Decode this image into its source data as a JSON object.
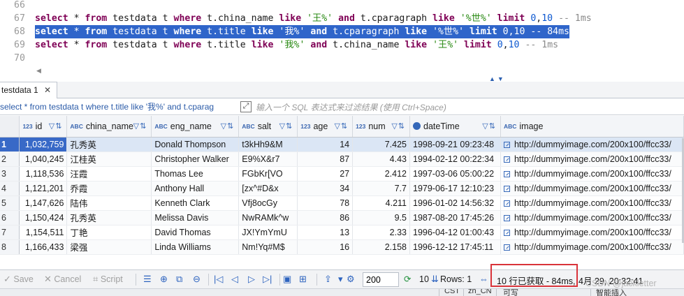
{
  "editor": {
    "lines": [
      {
        "num": "66",
        "segments": []
      },
      {
        "num": "67",
        "segments": [
          {
            "t": "select",
            "c": "kw"
          },
          {
            "t": " * ",
            "c": ""
          },
          {
            "t": "from",
            "c": "kw"
          },
          {
            "t": " testdata t ",
            "c": ""
          },
          {
            "t": "where",
            "c": "kw"
          },
          {
            "t": " t.china_name ",
            "c": ""
          },
          {
            "t": "like",
            "c": "kw"
          },
          {
            "t": " ",
            "c": ""
          },
          {
            "t": "'王%'",
            "c": "str"
          },
          {
            "t": " ",
            "c": ""
          },
          {
            "t": "and",
            "c": "kw"
          },
          {
            "t": " t.cparagraph ",
            "c": ""
          },
          {
            "t": "like",
            "c": "kw"
          },
          {
            "t": " ",
            "c": ""
          },
          {
            "t": "'%世%'",
            "c": "str"
          },
          {
            "t": " ",
            "c": ""
          },
          {
            "t": "limit",
            "c": "kw"
          },
          {
            "t": " ",
            "c": ""
          },
          {
            "t": "0",
            "c": "num"
          },
          {
            "t": ",",
            "c": ""
          },
          {
            "t": "10",
            "c": "num"
          },
          {
            "t": " -- 1ms",
            "c": "cmt"
          }
        ]
      },
      {
        "num": "68",
        "selected": true,
        "segments": [
          {
            "t": "select",
            "c": "kw"
          },
          {
            "t": " * ",
            "c": ""
          },
          {
            "t": "from",
            "c": "kw"
          },
          {
            "t": " testdata t ",
            "c": ""
          },
          {
            "t": "where",
            "c": "kw"
          },
          {
            "t": " t.title ",
            "c": ""
          },
          {
            "t": "like",
            "c": "kw"
          },
          {
            "t": " ",
            "c": ""
          },
          {
            "t": "'我%'",
            "c": "str"
          },
          {
            "t": " ",
            "c": ""
          },
          {
            "t": "and",
            "c": "kw"
          },
          {
            "t": " t.cparagraph ",
            "c": ""
          },
          {
            "t": "like",
            "c": "kw"
          },
          {
            "t": " ",
            "c": ""
          },
          {
            "t": "'%世%'",
            "c": "str"
          },
          {
            "t": " ",
            "c": ""
          },
          {
            "t": "limit",
            "c": "kw"
          },
          {
            "t": " ",
            "c": ""
          },
          {
            "t": "0",
            "c": "num"
          },
          {
            "t": ",",
            "c": ""
          },
          {
            "t": "10",
            "c": "num"
          },
          {
            "t": " -- 84ms",
            "c": "cmt"
          }
        ]
      },
      {
        "num": "69",
        "segments": [
          {
            "t": "select",
            "c": "kw"
          },
          {
            "t": " * ",
            "c": ""
          },
          {
            "t": "from",
            "c": "kw"
          },
          {
            "t": " testdata t ",
            "c": ""
          },
          {
            "t": "where",
            "c": "kw"
          },
          {
            "t": " t.title ",
            "c": ""
          },
          {
            "t": "like",
            "c": "kw"
          },
          {
            "t": " ",
            "c": ""
          },
          {
            "t": "'我%'",
            "c": "str"
          },
          {
            "t": " ",
            "c": ""
          },
          {
            "t": "and",
            "c": "kw"
          },
          {
            "t": " t.china_name ",
            "c": ""
          },
          {
            "t": "like",
            "c": "kw"
          },
          {
            "t": " ",
            "c": ""
          },
          {
            "t": "'王%'",
            "c": "str"
          },
          {
            "t": " ",
            "c": ""
          },
          {
            "t": "limit",
            "c": "kw"
          },
          {
            "t": " ",
            "c": ""
          },
          {
            "t": "0",
            "c": "num"
          },
          {
            "t": ",",
            "c": ""
          },
          {
            "t": "10",
            "c": "num"
          },
          {
            "t": " -- 1ms",
            "c": "cmt"
          }
        ]
      },
      {
        "num": "70",
        "segments": []
      }
    ]
  },
  "results_tab": {
    "label": "testdata 1",
    "close": "✕"
  },
  "filter": {
    "query": "select * from testdata t where t.title like '我%' and t.cparag",
    "placeholder": "输入一个 SQL 表达式来过滤结果 (使用 Ctrl+Space)"
  },
  "grid": {
    "columns": [
      {
        "name": "id",
        "type": "123"
      },
      {
        "name": "china_name",
        "type": "ABC"
      },
      {
        "name": "eng_name",
        "type": "ABC"
      },
      {
        "name": "salt",
        "type": "ABC"
      },
      {
        "name": "age",
        "type": "123"
      },
      {
        "name": "num",
        "type": "123"
      },
      {
        "name": "dateTime",
        "type": "clock"
      },
      {
        "name": "image",
        "type": "ABC"
      }
    ],
    "rows": [
      {
        "rn": "1",
        "cells": [
          "1,032,759",
          "孔秀英",
          "Donald Thompson",
          "t3kHh9&M",
          "14",
          "7.425",
          "1998-09-21 09:23:48",
          "http://dummyimage.com/200x100/ffcc33/"
        ]
      },
      {
        "rn": "2",
        "cells": [
          "1,040,245",
          "江桂英",
          "Christopher Walker",
          "E9%X&r7",
          "87",
          "4.43",
          "1994-02-12 00:22:34",
          "http://dummyimage.com/200x100/ffcc33/"
        ]
      },
      {
        "rn": "3",
        "cells": [
          "1,118,536",
          "汪霞",
          "Thomas Lee",
          "FGbKr[VO",
          "27",
          "2.412",
          "1997-03-06 05:00:22",
          "http://dummyimage.com/200x100/ffcc33/"
        ]
      },
      {
        "rn": "4",
        "cells": [
          "1,121,201",
          "乔霞",
          "Anthony Hall",
          "[zx^#D&x",
          "34",
          "7.7",
          "1979-06-17 12:10:23",
          "http://dummyimage.com/200x100/ffcc33/"
        ]
      },
      {
        "rn": "5",
        "cells": [
          "1,147,626",
          "陆伟",
          "Kenneth Clark",
          "Vfj8ocGy",
          "78",
          "4.211",
          "1996-01-02 14:56:32",
          "http://dummyimage.com/200x100/ffcc33/"
        ]
      },
      {
        "rn": "6",
        "cells": [
          "1,150,424",
          "孔秀英",
          "Melissa Davis",
          "NwRAMk^w",
          "86",
          "9.5",
          "1987-08-20 17:45:26",
          "http://dummyimage.com/200x100/ffcc33/"
        ]
      },
      {
        "rn": "7",
        "cells": [
          "1,154,511",
          "丁艳",
          "David Thomas",
          "JX!YmYmU",
          "13",
          "2.33",
          "1996-04-12 01:00:43",
          "http://dummyimage.com/200x100/ffcc33/"
        ]
      },
      {
        "rn": "8",
        "cells": [
          "1,166,433",
          "梁强",
          "Linda Williams",
          "Nm!Yq#M$",
          "16",
          "2.158",
          "1996-12-12 17:45:11",
          "http://dummyimage.com/200x100/ffcc33/"
        ]
      }
    ]
  },
  "toolbar": {
    "save": "Save",
    "cancel": "Cancel",
    "script": "Script",
    "fetch_size": "200",
    "refresh_count": "10",
    "rows_label": "Rows: 1",
    "status": "10 行已获取 - 84ms,",
    "date": "4月 29, 20:32:41"
  },
  "statusbar": {
    "items": [
      "CST",
      "zh_CN",
      "可写",
      "智能插入"
    ]
  },
  "watermark": "CSDN @jackletter"
}
